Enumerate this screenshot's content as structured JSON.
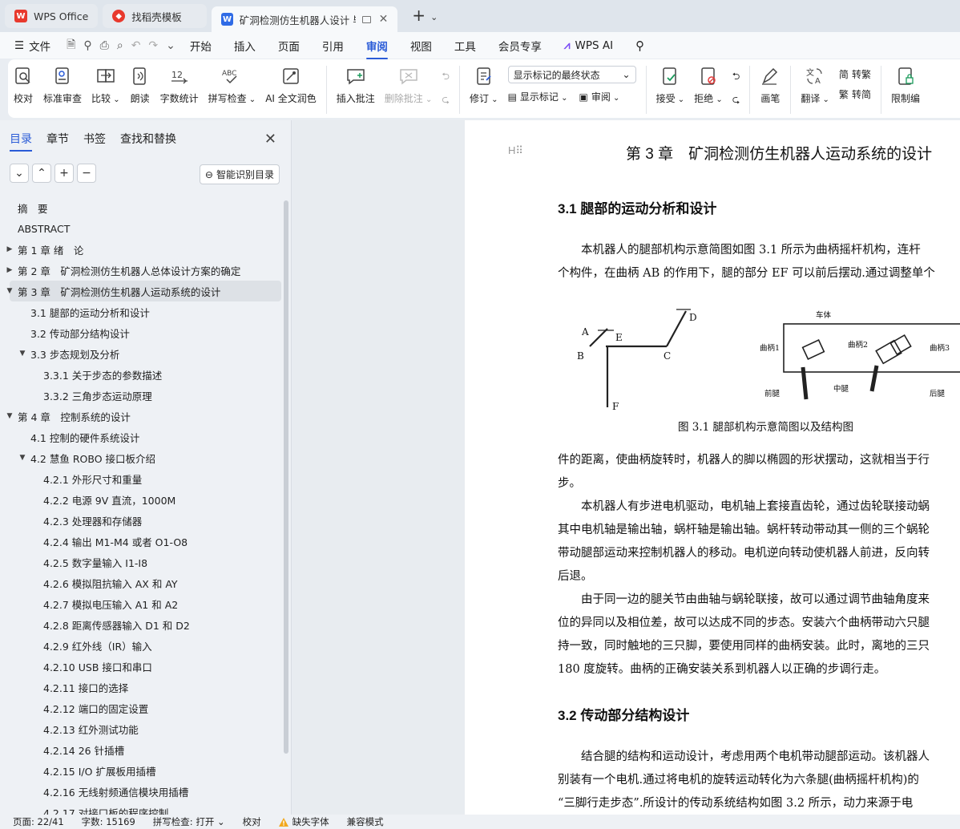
{
  "tabs": [
    {
      "label": "WPS Office",
      "icon": "wps-logo-icon"
    },
    {
      "label": "找稻壳模板",
      "icon": "docer-icon"
    },
    {
      "label": "矿洞检测仿生机器人设计 毕业",
      "icon": "writer-icon"
    }
  ],
  "menu": {
    "file": "文件",
    "items": [
      "开始",
      "插入",
      "页面",
      "引用",
      "审阅",
      "视图",
      "工具",
      "会员专享"
    ],
    "active": "审阅",
    "ai": "WPS AI"
  },
  "ribbon": {
    "proofread": "校对",
    "std_review": "标准审查",
    "compare": "比较",
    "read_aloud": "朗读",
    "word_count": "字数统计",
    "spell_check": "拼写检查",
    "ai_polish": "AI 全文润色",
    "insert_comment": "插入批注",
    "delete_comment": "删除批注",
    "track": "修订",
    "markup_select": "显示标记的最终状态",
    "show_markup": "显示标记",
    "review": "审阅",
    "accept": "接受",
    "reject": "拒绝",
    "pen": "画笔",
    "translate": "翻译",
    "to_traditional": "转繁",
    "to_simplified": "转简",
    "restrict": "限制编"
  },
  "nav": {
    "tabs": [
      "目录",
      "章节",
      "书签",
      "查找和替换"
    ],
    "smart_btn": "智能识别目录",
    "toc": [
      {
        "label": "摘　要",
        "level": 1,
        "arrow": ""
      },
      {
        "label": "ABSTRACT",
        "level": 1,
        "arrow": ""
      },
      {
        "label": "第 1 章  绪　论",
        "level": 1,
        "arrow": "▶"
      },
      {
        "label": "第 2 章　矿洞检测仿生机器人总体设计方案的确定",
        "level": 1,
        "arrow": "▶"
      },
      {
        "label": "第 3 章　矿洞检测仿生机器人运动系统的设计",
        "level": 1,
        "arrow": "▼",
        "selected": true
      },
      {
        "label": "3.1 腿部的运动分析和设计",
        "level": 2,
        "arrow": ""
      },
      {
        "label": "3.2 传动部分结构设计",
        "level": 2,
        "arrow": ""
      },
      {
        "label": "3.3 步态规划及分析",
        "level": 2,
        "arrow": "▼"
      },
      {
        "label": "3.3.1 关于步态的参数描述",
        "level": 3,
        "arrow": ""
      },
      {
        "label": "3.3.2  三角步态运动原理",
        "level": 3,
        "arrow": ""
      },
      {
        "label": "第 4 章　控制系统的设计",
        "level": 1,
        "arrow": "▼"
      },
      {
        "label": "4.1 控制的硬件系统设计",
        "level": 2,
        "arrow": ""
      },
      {
        "label": "4.2 慧鱼  ROBO 接口板介绍",
        "level": 2,
        "arrow": "▼"
      },
      {
        "label": "4.2.1  外形尺寸和重量",
        "level": 3,
        "arrow": ""
      },
      {
        "label": "4.2.2  电源 9V 直流，1000M",
        "level": 3,
        "arrow": ""
      },
      {
        "label": "4.2.3  处理器和存储器",
        "level": 3,
        "arrow": ""
      },
      {
        "label": "4.2.4  输出 M1-M4 或者 O1-O8",
        "level": 3,
        "arrow": ""
      },
      {
        "label": "4.2.5  数字量输入 I1-I8",
        "level": 3,
        "arrow": ""
      },
      {
        "label": "4.2.6  模拟阻抗输入 AX 和 AY",
        "level": 3,
        "arrow": ""
      },
      {
        "label": "4.2.7  模拟电压输入 A1 和 A2",
        "level": 3,
        "arrow": ""
      },
      {
        "label": "4.2.8  距离传感器输入 D1 和 D2",
        "level": 3,
        "arrow": ""
      },
      {
        "label": "4.2.9  红外线（IR）输入",
        "level": 3,
        "arrow": ""
      },
      {
        "label": "4.2.10 USB 接口和串口",
        "level": 3,
        "arrow": ""
      },
      {
        "label": "4.2.11  接口的选择",
        "level": 3,
        "arrow": ""
      },
      {
        "label": "4.2.12  端口的固定设置",
        "level": 3,
        "arrow": ""
      },
      {
        "label": "4.2.13  红外测试功能",
        "level": 3,
        "arrow": ""
      },
      {
        "label": "4.2.14 26 针插槽",
        "level": 3,
        "arrow": ""
      },
      {
        "label": "4.2.15 I/O 扩展板用插槽",
        "level": 3,
        "arrow": ""
      },
      {
        "label": "4.2.16  无线射频通信模块用插槽",
        "level": 3,
        "arrow": ""
      },
      {
        "label": "4.2.17 对接口板的程序控制",
        "level": 3,
        "arrow": ""
      }
    ]
  },
  "doc": {
    "chapter_title": "第 3 章　矿洞检测仿生机器人运动系统的设计",
    "h31": "3.1 腿部的运动分析和设计",
    "p1": [
      "　　本机器人的腿部机构示意简图如图 3.1 所示为曲柄摇杆机构，连杆",
      "个构件，在曲柄 AB 的作用下，腿的部分 EF 可以前后摆动.通过调整单个"
    ],
    "fig_labels": {
      "A": "A",
      "B": "B",
      "C": "C",
      "D": "D",
      "E": "E",
      "F": "F",
      "body": "车体",
      "crank1": "曲柄1",
      "crank2": "曲柄2",
      "crank3": "曲柄3",
      "front": "前腿",
      "mid": "中腿",
      "rear": "后腿"
    },
    "caption": "图 3.1  腿部机构示意简图以及结构图",
    "p2": [
      "件的距离，使曲柄旋转时，机器人的脚以椭圆的形状摆动，这就相当于行",
      "步。"
    ],
    "p3": [
      "　　本机器人有步进电机驱动，电机轴上套接直齿轮，通过齿轮联接动蜗",
      "其中电机轴是输出轴，蜗杆轴是输出轴。蜗杆转动带动其一侧的三个蜗轮",
      "带动腿部运动来控制机器人的移动。电机逆向转动使机器人前进，反向转",
      "后退。"
    ],
    "p4": [
      "　　由于同一边的腿关节由曲轴与蜗轮联接，故可以通过调节曲轴角度来",
      "位的异同以及相位差，故可以达成不同的步态。安装六个曲柄带动六只腿",
      "持一致，同时触地的三只脚，要使用同样的曲柄安装。此时，离地的三只",
      "180 度旋转。曲柄的正确安装关系到机器人以正确的步调行走。"
    ],
    "h32": "3.2 传动部分结构设计",
    "p5": [
      "　　结合腿的结构和运动设计，考虑用两个电机带动腿部运动。该机器人",
      "别装有一个电机.通过将电机的旋转运动转化为六条腿(曲柄摇杆机构)的",
      "“三脚行走步态”.所设计的传动系统结构如图 3.2 所示，动力来源于电"
    ]
  },
  "status": {
    "page": "页面: 22/41",
    "words": "字数: 15169",
    "spell": "拼写检查: 打开",
    "proof": "校对",
    "missing_font": "缺失字体",
    "compat": "兼容模式"
  },
  "colors": {
    "accent": "#2a5bd7",
    "wps_red": "#e8392d",
    "writer_blue": "#2f6be6"
  }
}
